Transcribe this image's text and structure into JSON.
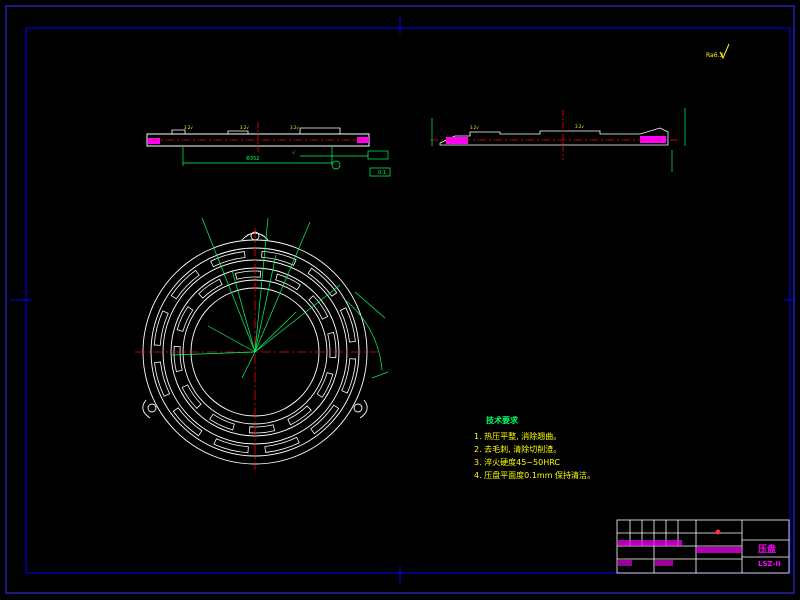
{
  "drawing": {
    "roughness_label": "Ra6.3",
    "gap_label": "0.1",
    "colors": {
      "background": "#000000",
      "frame": "#0000ff",
      "geometry": "#ffffff",
      "centerline": "#ff0000",
      "dimension": "#00ff66",
      "notes": "#ffff00",
      "titleblock_text": "#ff00ff"
    }
  },
  "notes": {
    "title": "技术要求",
    "items": [
      "1. 热压平整, 消除翘曲。",
      "2. 去毛刺, 清除切削渣。",
      "3. 淬火硬度45~50HRC",
      "4. 压盘平面度0.1mm 保持清洁。"
    ]
  },
  "titleblock": {
    "part_name": "压盘",
    "drawing_no": "LSZ-II"
  }
}
